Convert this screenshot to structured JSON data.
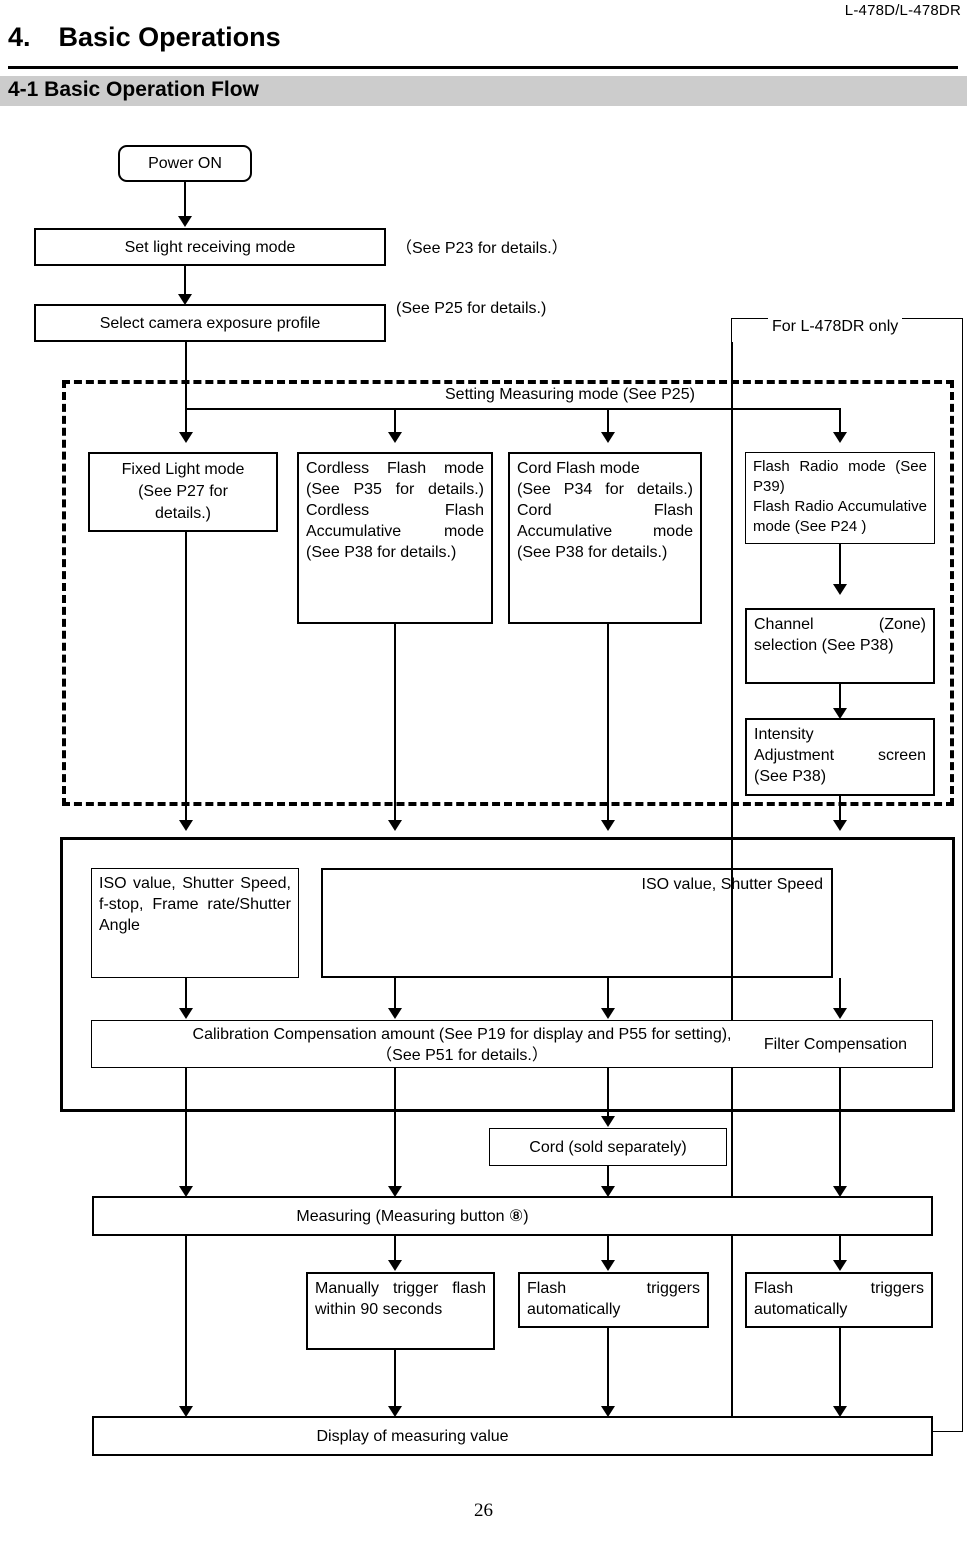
{
  "header": {
    "model": "L-478D/L-478DR",
    "chapter_number": "4.",
    "chapter_title": "Basic Operations",
    "section_title": "4-1 Basic Operation Flow"
  },
  "footer": {
    "page_number": "26"
  },
  "flow": {
    "power_on": "Power ON",
    "set_light_mode": "Set light receiving mode",
    "set_light_mode_note": "（See P23 for details.）",
    "select_profile": "Select camera exposure profile",
    "select_profile_note": "(See P25 for details.)",
    "dr_region_label": "For L-478DR only",
    "dashed_region_label": "Setting Measuring mode (See P25)",
    "mode_fixed": {
      "line1": "Fixed Light mode",
      "line2": "(See P27 for",
      "line3": "details.)"
    },
    "mode_cordless": {
      "p1": "Cordless Flash mode (See P35 for details.)",
      "p2": "Cordless Flash Accumulative mode",
      "p3": "(See P38 for details.)"
    },
    "mode_cord": {
      "p1": "Cord Flash mode",
      "p2": "(See P34 for details.)",
      "p3": "Cord Flash Accumulative mode",
      "p4": "(See P38 for details.)"
    },
    "mode_radio": {
      "p1": "Flash Radio mode (See P39)",
      "p2": "Flash Radio Accumulative mode (See P24 )"
    },
    "channel_selection": "Channel (Zone) selection (See P38)",
    "intensity_adjustment": {
      "p1": "Intensity",
      "p2": "Adjustment screen",
      "p3": "(See P38)"
    },
    "iso_left": "ISO value, Shutter Speed, f-stop, Frame rate/Shutter Angle",
    "iso_mid": "ISO value, Shutter Speed",
    "calibration_line1": "Calibration Compensation amount (See P19 for display and P55 for setting),",
    "calibration_line2": "（See P51 for details.）",
    "filter_compensation": "Filter Compensation",
    "cord_sold_separately": "Cord (sold separately)",
    "measuring": "Measuring (Measuring button  ⑧)",
    "manual_trigger": "Manually trigger flash within 90 seconds",
    "auto_trigger_1": "Flash triggers automatically",
    "auto_trigger_2": "Flash triggers automatically",
    "display_value": "Display of measuring value"
  }
}
